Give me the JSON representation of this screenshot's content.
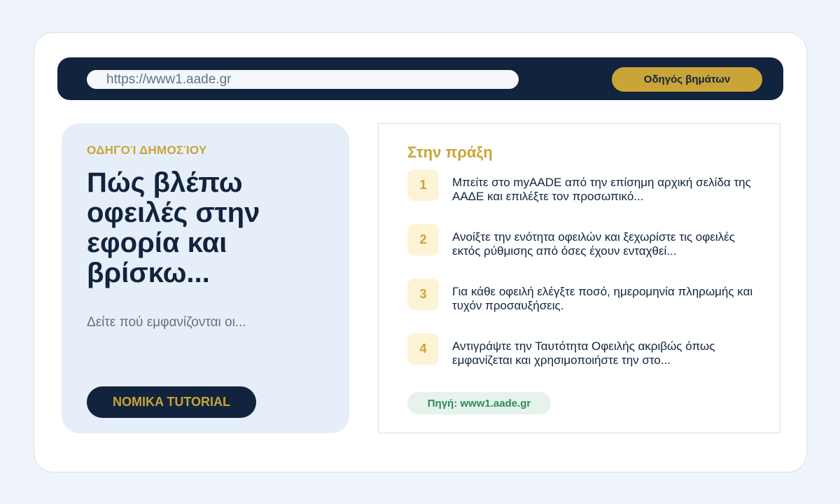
{
  "browser": {
    "url": "https://www1.aade.gr",
    "guide_button": "Οδηγός βημάτων"
  },
  "hero": {
    "kicker": "ΟΔΗΓΟΊ ΔΗΜΟΣΊΟΥ",
    "title": "Πώς βλέπω οφειλές στην εφορία και βρίσκω...",
    "subtitle": "Δείτε πού εμφανίζονται οι...",
    "cta": "NOMIKA TUTORIAL"
  },
  "practice": {
    "title": "Στην πράξη",
    "steps": [
      {
        "num": "1",
        "text": "Μπείτε στο myAADE από την επίσημη αρχική σελίδα της ΑΑΔΕ και επιλέξτε τον προσωπικό..."
      },
      {
        "num": "2",
        "text": "Ανοίξτε την ενότητα οφειλών και ξεχωρίστε τις οφειλές εκτός ρύθμισης από όσες έχουν ενταχθεί..."
      },
      {
        "num": "3",
        "text": "Για κάθε οφειλή ελέγξτε ποσό, ημερομηνία πληρωμής και τυχόν προσαυξήσεις."
      },
      {
        "num": "4",
        "text": "Αντιγράψτε την Ταυτότητα Οφειλής ακριβώς όπως εμφανίζεται και χρησιμοποιήστε την στο..."
      }
    ],
    "source": "Πηγή: www1.aade.gr"
  },
  "colors": {
    "navy": "#12233d",
    "gold": "#c9a437",
    "panel_blue": "#e6eff9",
    "source_green": "#2e8b5a"
  }
}
